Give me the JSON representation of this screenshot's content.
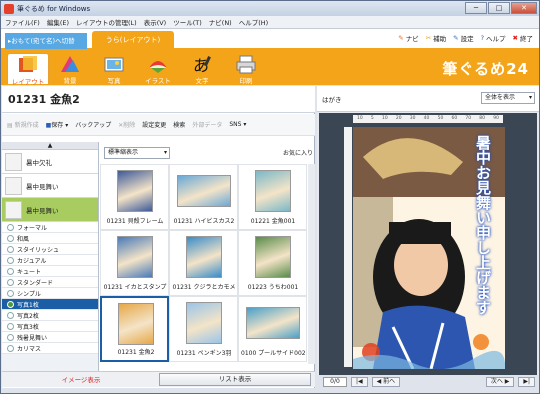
{
  "window": {
    "title": "筆ぐるめ for Windows",
    "min": "─",
    "max": "□",
    "close": "✕"
  },
  "menu": [
    "ファイル(F)",
    "編集(E)",
    "レイアウトの管理(L)",
    "表示(V)",
    "ツール(T)",
    "ナビ(N)",
    "ヘルプ(H)"
  ],
  "tabs": {
    "omote": "▸おもて(宛て名)へ切替",
    "ura": "うら(レイアウト)"
  },
  "right_tools": {
    "navi": "ナビ",
    "hosoku": "補助",
    "settei": "設定",
    "help": "ヘルプ",
    "exit": "終了"
  },
  "ribbon": {
    "layout": "レイアウト",
    "haikei": "背景",
    "shashin": "写真",
    "illust": "イラスト",
    "moji": "文字",
    "insatsu": "印刷",
    "logo": "筆ぐるめ24"
  },
  "section": {
    "title": "01231 金魚2"
  },
  "toolbar2": {
    "new": "新規作成",
    "save": "保存",
    "backup": "バックアップ",
    "delete": "削除",
    "change": "設定変更",
    "search": "検索",
    "external": "外部データ",
    "sns": "SNS"
  },
  "categories_big": [
    {
      "label": "暑中欠礼",
      "selected": false
    },
    {
      "label": "暑中見舞い",
      "selected": false
    },
    {
      "label": "暑中見舞い",
      "selected": true
    }
  ],
  "categories_small": [
    {
      "label": "フォーマル",
      "selected": false
    },
    {
      "label": "和風",
      "selected": false
    },
    {
      "label": "スタイリッシュ",
      "selected": false
    },
    {
      "label": "カジュアル",
      "selected": false
    },
    {
      "label": "キュート",
      "selected": false
    },
    {
      "label": "スタンダード",
      "selected": false
    },
    {
      "label": "シンプル",
      "selected": false
    },
    {
      "label": "写真1枚",
      "selected": true
    },
    {
      "label": "写真2枚",
      "selected": false
    },
    {
      "label": "写真3枚",
      "selected": false
    },
    {
      "label": "残暑見舞い",
      "selected": false
    },
    {
      "label": "カリマス",
      "selected": false
    }
  ],
  "view": {
    "select": "標準縮表示",
    "favorites": "お気に入り"
  },
  "thumbnails": [
    {
      "caption": "01231 貝殻フレーム",
      "selected": false,
      "color": "#3d5a9a"
    },
    {
      "caption": "01231 ハイビスカス2",
      "selected": false,
      "color": "#6aa8d6"
    },
    {
      "caption": "01221 金魚001",
      "selected": false,
      "color": "#7ab8c8"
    },
    {
      "caption": "01231 イカとスタンプ",
      "selected": false,
      "color": "#4a7ab8"
    },
    {
      "caption": "01231 クジラとカモメ",
      "selected": false,
      "color": "#3a8cc8"
    },
    {
      "caption": "01223 うちわ001",
      "selected": false,
      "color": "#5a8c4a"
    },
    {
      "caption": "01231 金魚2",
      "selected": true,
      "color": "#e6a848"
    },
    {
      "caption": "01231 ペンギン3羽",
      "selected": false,
      "color": "#9ac4e8"
    },
    {
      "caption": "0100 プールサイド002",
      "selected": false,
      "color": "#4aa0c8"
    }
  ],
  "bottom_buttons": {
    "image_view": "イメージ表示",
    "list_view": "リスト表示"
  },
  "preview": {
    "label": "はがき",
    "zoom": "全体を表示",
    "ruler": [
      "10",
      "5",
      "10",
      "20",
      "30",
      "40",
      "50",
      "60",
      "70",
      "80",
      "90"
    ],
    "greeting": "暑中お見舞い申し上げます",
    "page": "0/0",
    "prev": "前へ",
    "next": "次へ"
  },
  "colors": {
    "accent": "#f4a418",
    "ribbon_text": "#ffffff",
    "selected_blue": "#1c5ea6"
  }
}
